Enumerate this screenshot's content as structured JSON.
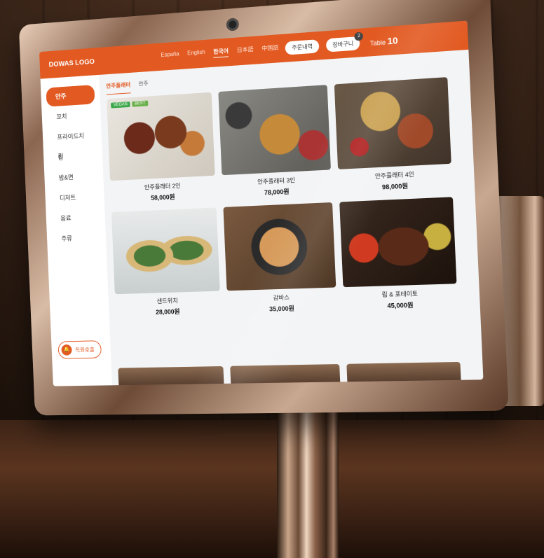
{
  "header": {
    "logo": "DOWAS LOGO",
    "languages": [
      "España",
      "English",
      "한국어",
      "日本語",
      "中国語"
    ],
    "active_language_index": 2,
    "order_history_label": "주문내역",
    "cart_label": "장바구니",
    "cart_count": "2",
    "table_prefix": "Table",
    "table_number": "10"
  },
  "sidebar": {
    "categories": [
      "안주",
      "꼬치",
      "프라이드치킨",
      "찐",
      "밥&면",
      "디저트",
      "음료",
      "주류"
    ],
    "active_index": 0,
    "staff_call_label": "직원호출"
  },
  "subtabs": [
    "안주플래터",
    "안주"
  ],
  "menu": [
    {
      "name": "안주플래터 2인",
      "price": "58,000원",
      "tags": [
        "VEGAN",
        "BEST"
      ]
    },
    {
      "name": "안주플래터 3인",
      "price": "78,000원"
    },
    {
      "name": "안주플래터 4인",
      "price": "98,000원"
    },
    {
      "name": "샌드위치",
      "price": "28,000원"
    },
    {
      "name": "감바스",
      "price": "35,000원"
    },
    {
      "name": "립 & 포테이토",
      "price": "45,000원"
    }
  ],
  "colors": {
    "accent": "#e25a22",
    "screen_bg": "#f3f4f6",
    "tag_green": "#3ca84a"
  }
}
